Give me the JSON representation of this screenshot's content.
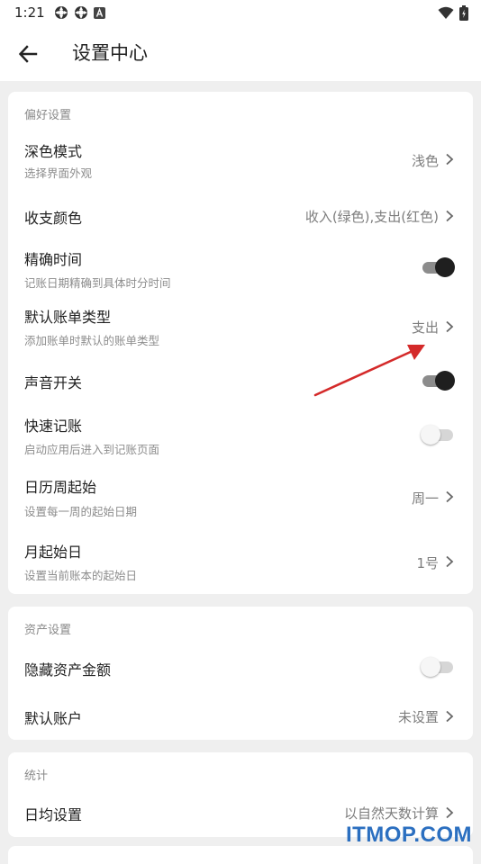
{
  "status_bar": {
    "time": "1:21",
    "icons": [
      "sync-icon",
      "sync-icon",
      "notification-a-icon"
    ],
    "right_icons": [
      "wifi-icon",
      "battery-icon"
    ]
  },
  "app_bar": {
    "title": "设置中心",
    "back_icon": "arrow-left-icon"
  },
  "preferences": {
    "title": "偏好设置",
    "dark_mode": {
      "title": "深色模式",
      "subtitle": "选择界面外观",
      "value": "浅色"
    },
    "income_color": {
      "title": "收支颜色",
      "value": "收入(绿色),支出(红色)"
    },
    "precise_time": {
      "title": "精确时间",
      "subtitle": "记账日期精确到具体时分时间",
      "enabled": true
    },
    "default_bill_type": {
      "title": "默认账单类型",
      "subtitle": "添加账单时默认的账单类型",
      "value": "支出"
    },
    "sound": {
      "title": "声音开关",
      "enabled": true
    },
    "quick_entry": {
      "title": "快速记账",
      "subtitle": "启动应用后进入到记账页面",
      "enabled": false
    },
    "week_start": {
      "title": "日历周起始",
      "subtitle": "设置每一周的起始日期",
      "value": "周一"
    },
    "month_start": {
      "title": "月起始日",
      "subtitle": "设置当前账本的起始日",
      "value": "1号"
    }
  },
  "assets": {
    "title": "资产设置",
    "hide_amount": {
      "title": "隐藏资产金额",
      "enabled": false
    },
    "default_account": {
      "title": "默认账户",
      "value": "未设置"
    }
  },
  "statistics": {
    "title": "统计",
    "daily_average": {
      "title": "日均设置",
      "value": "以自然天数计算"
    }
  },
  "watermark": "ITMOP.COM",
  "colors": {
    "background": "#efefef",
    "card": "#ffffff",
    "annotation_arrow": "#d42a2a",
    "toggle_on_knob": "#1f1f1f",
    "watermark": "#2b6fc0"
  }
}
